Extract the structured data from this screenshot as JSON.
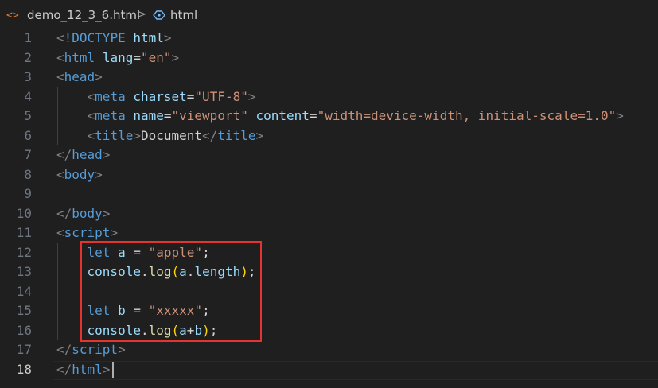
{
  "breadcrumb": {
    "file_icon": "<>",
    "file": "demo_12_3_6.html",
    "separator": ">",
    "symbol": "html"
  },
  "editor": {
    "active_line": 18,
    "lines": [
      {
        "n": "1",
        "tokens": [
          [
            "punc",
            "<"
          ],
          [
            "tag",
            "!DOCTYPE"
          ],
          [
            "txt",
            " "
          ],
          [
            "attr",
            "html"
          ],
          [
            "punc",
            ">"
          ]
        ]
      },
      {
        "n": "2",
        "tokens": [
          [
            "punc",
            "<"
          ],
          [
            "tag",
            "html"
          ],
          [
            "txt",
            " "
          ],
          [
            "attr",
            "lang"
          ],
          [
            "txt",
            "="
          ],
          [
            "str",
            "\"en\""
          ],
          [
            "punc",
            ">"
          ]
        ]
      },
      {
        "n": "3",
        "tokens": [
          [
            "punc",
            "<"
          ],
          [
            "tag",
            "head"
          ],
          [
            "punc",
            ">"
          ]
        ]
      },
      {
        "n": "4",
        "tokens": [
          [
            "txt",
            "    "
          ],
          [
            "punc",
            "<"
          ],
          [
            "tag",
            "meta"
          ],
          [
            "txt",
            " "
          ],
          [
            "attr",
            "charset"
          ],
          [
            "txt",
            "="
          ],
          [
            "str",
            "\"UTF-8\""
          ],
          [
            "punc",
            ">"
          ]
        ]
      },
      {
        "n": "5",
        "tokens": [
          [
            "txt",
            "    "
          ],
          [
            "punc",
            "<"
          ],
          [
            "tag",
            "meta"
          ],
          [
            "txt",
            " "
          ],
          [
            "attr",
            "name"
          ],
          [
            "txt",
            "="
          ],
          [
            "str",
            "\"viewport\""
          ],
          [
            "txt",
            " "
          ],
          [
            "attr",
            "content"
          ],
          [
            "txt",
            "="
          ],
          [
            "str",
            "\"width=device-width, initial-scale=1.0\""
          ],
          [
            "punc",
            ">"
          ]
        ]
      },
      {
        "n": "6",
        "tokens": [
          [
            "txt",
            "    "
          ],
          [
            "punc",
            "<"
          ],
          [
            "tag",
            "title"
          ],
          [
            "punc",
            ">"
          ],
          [
            "txt",
            "Document"
          ],
          [
            "punc",
            "</"
          ],
          [
            "tag",
            "title"
          ],
          [
            "punc",
            ">"
          ]
        ]
      },
      {
        "n": "7",
        "tokens": [
          [
            "punc",
            "</"
          ],
          [
            "tag",
            "head"
          ],
          [
            "punc",
            ">"
          ]
        ]
      },
      {
        "n": "8",
        "tokens": [
          [
            "punc",
            "<"
          ],
          [
            "tag",
            "body"
          ],
          [
            "punc",
            ">"
          ]
        ]
      },
      {
        "n": "9",
        "tokens": []
      },
      {
        "n": "10",
        "tokens": [
          [
            "punc",
            "</"
          ],
          [
            "tag",
            "body"
          ],
          [
            "punc",
            ">"
          ]
        ]
      },
      {
        "n": "11",
        "tokens": [
          [
            "punc",
            "<"
          ],
          [
            "tag",
            "script"
          ],
          [
            "punc",
            ">"
          ]
        ]
      },
      {
        "n": "12",
        "tokens": [
          [
            "txt",
            "    "
          ],
          [
            "kw",
            "let"
          ],
          [
            "txt",
            " "
          ],
          [
            "var",
            "a"
          ],
          [
            "txt",
            " = "
          ],
          [
            "str",
            "\"apple\""
          ],
          [
            "txt",
            ";"
          ]
        ]
      },
      {
        "n": "13",
        "tokens": [
          [
            "txt",
            "    "
          ],
          [
            "var",
            "console"
          ],
          [
            "txt",
            "."
          ],
          [
            "fn",
            "log"
          ],
          [
            "paren",
            "("
          ],
          [
            "var",
            "a"
          ],
          [
            "txt",
            "."
          ],
          [
            "var",
            "length"
          ],
          [
            "paren",
            ")"
          ],
          [
            "txt",
            ";"
          ]
        ]
      },
      {
        "n": "14",
        "tokens": []
      },
      {
        "n": "15",
        "tokens": [
          [
            "txt",
            "    "
          ],
          [
            "kw",
            "let"
          ],
          [
            "txt",
            " "
          ],
          [
            "var",
            "b"
          ],
          [
            "txt",
            " = "
          ],
          [
            "str",
            "\"xxxxx\""
          ],
          [
            "txt",
            ";"
          ]
        ]
      },
      {
        "n": "16",
        "tokens": [
          [
            "txt",
            "    "
          ],
          [
            "var",
            "console"
          ],
          [
            "txt",
            "."
          ],
          [
            "fn",
            "log"
          ],
          [
            "paren",
            "("
          ],
          [
            "var",
            "a"
          ],
          [
            "txt",
            "+"
          ],
          [
            "var",
            "b"
          ],
          [
            "paren",
            ")"
          ],
          [
            "txt",
            ";"
          ]
        ]
      },
      {
        "n": "17",
        "tokens": [
          [
            "punc",
            "</"
          ],
          [
            "tag",
            "script"
          ],
          [
            "punc",
            ">"
          ]
        ]
      },
      {
        "n": "18",
        "tokens": [
          [
            "punc",
            "</"
          ],
          [
            "tag",
            "html"
          ],
          [
            "punc",
            ">"
          ]
        ]
      }
    ]
  },
  "annotation": {
    "box_color": "#e3342f",
    "highlighted_lines": [
      12,
      16
    ]
  },
  "colors": {
    "background": "#1f1f1f",
    "tag": "#569cd6",
    "punctuation": "#808080",
    "attribute": "#9cdcfe",
    "string": "#ce9178",
    "function": "#dcdcaa",
    "bracket": "#ffd700"
  }
}
